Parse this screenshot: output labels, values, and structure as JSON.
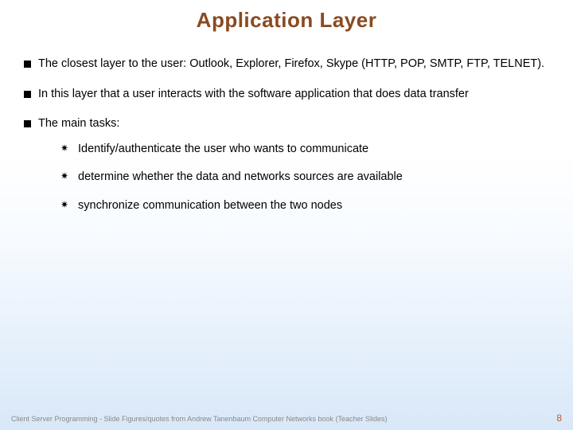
{
  "title": "Application Layer",
  "bullets": [
    {
      "text": "The closest layer to the user: Outlook, Explorer, Firefox, Skype (HTTP, POP, SMTP, FTP, TELNET)."
    },
    {
      "text": " In this layer that a user interacts with the software application that does data transfer"
    },
    {
      "text": "The main tasks:",
      "sub": [
        "Identify/authenticate the user who wants to communicate",
        "determine whether the data and networks sources are available",
        "synchronize communication between the two nodes"
      ]
    }
  ],
  "footer": {
    "left": "Client Server Programming    - Slide Figures/quotes from Andrew Tanenbaum Computer Networks book (Teacher Slides)",
    "page": "8"
  }
}
